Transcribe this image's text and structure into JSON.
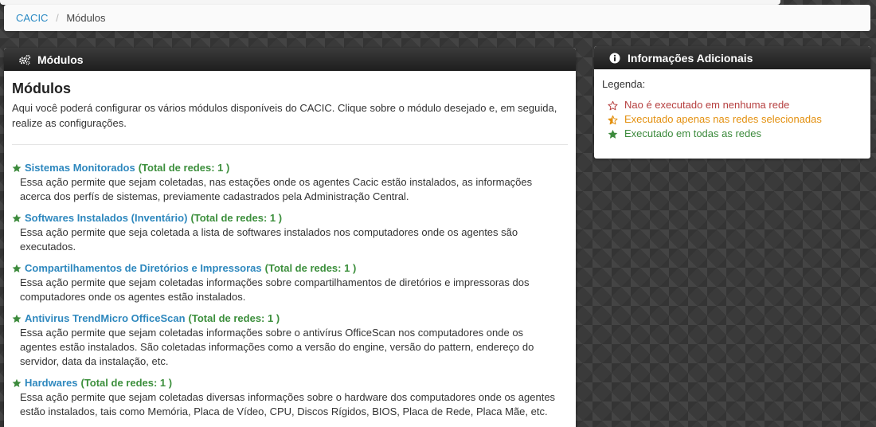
{
  "breadcrumb": {
    "home": "CACIC",
    "separator": "/",
    "current": "Módulos"
  },
  "main_panel": {
    "header_title": "Módulos",
    "title": "Módulos",
    "description": "Aqui você poderá configurar os vários módulos disponíveis do CACIC. Clique sobre o módulo desejado e, em seguida, realize as configurações.",
    "modules": [
      {
        "name": "Sistemas Monitorados",
        "total": "(Total de redes: 1 )",
        "description": "Essa ação permite que sejam coletadas, nas estações onde os agentes Cacic estão instalados, as informações acerca dos perfís de sistemas, previamente cadastrados pela Administração Central."
      },
      {
        "name": "Softwares Instalados (Inventário)",
        "total": "(Total de redes: 1 )",
        "description": "Essa ação permite que seja coletada a lista de softwares instalados nos computadores onde os agentes são executados."
      },
      {
        "name": "Compartilhamentos de Diretórios e Impressoras",
        "total": "(Total de redes: 1 )",
        "description": "Essa ação permite que sejam coletadas informações sobre compartilhamentos de diretórios e impressoras dos computadores onde os agentes estão instalados."
      },
      {
        "name": "Antivirus TrendMicro OfficeScan",
        "total": "(Total de redes: 1 )",
        "description": "Essa ação permite que sejam coletadas informações sobre o antivírus OfficeScan nos computadores onde os agentes estão instalados. São coletadas informações como a versão do engine, versão do pattern, endereço do servidor, data da instalação, etc."
      },
      {
        "name": "Hardwares",
        "total": "(Total de redes: 1 )",
        "description": "Essa ação permite que sejam coletadas diversas informações sobre o hardware dos computadores onde os agentes estão instalados, tais como Memória, Placa de Vídeo, CPU, Discos Rígidos, BIOS, Placa de Rede, Placa Mãe, etc."
      }
    ]
  },
  "side_panel": {
    "header_title": "Informações Adicionais",
    "legend_label": "Legenda:",
    "legend": [
      {
        "icon": "star-empty-icon",
        "text": "Nao é executado em nenhuma rede",
        "color": "#b64040"
      },
      {
        "icon": "star-half-icon",
        "text": "Executado apenas nas redes selecionadas",
        "color": "#e3900f"
      },
      {
        "icon": "star-full-icon",
        "text": "Executado em todas as redes",
        "color": "#3c8a3c"
      }
    ]
  },
  "colors": {
    "link": "#2e88be",
    "green": "#3c8f3c",
    "header_bg": "#2a2a2a"
  }
}
